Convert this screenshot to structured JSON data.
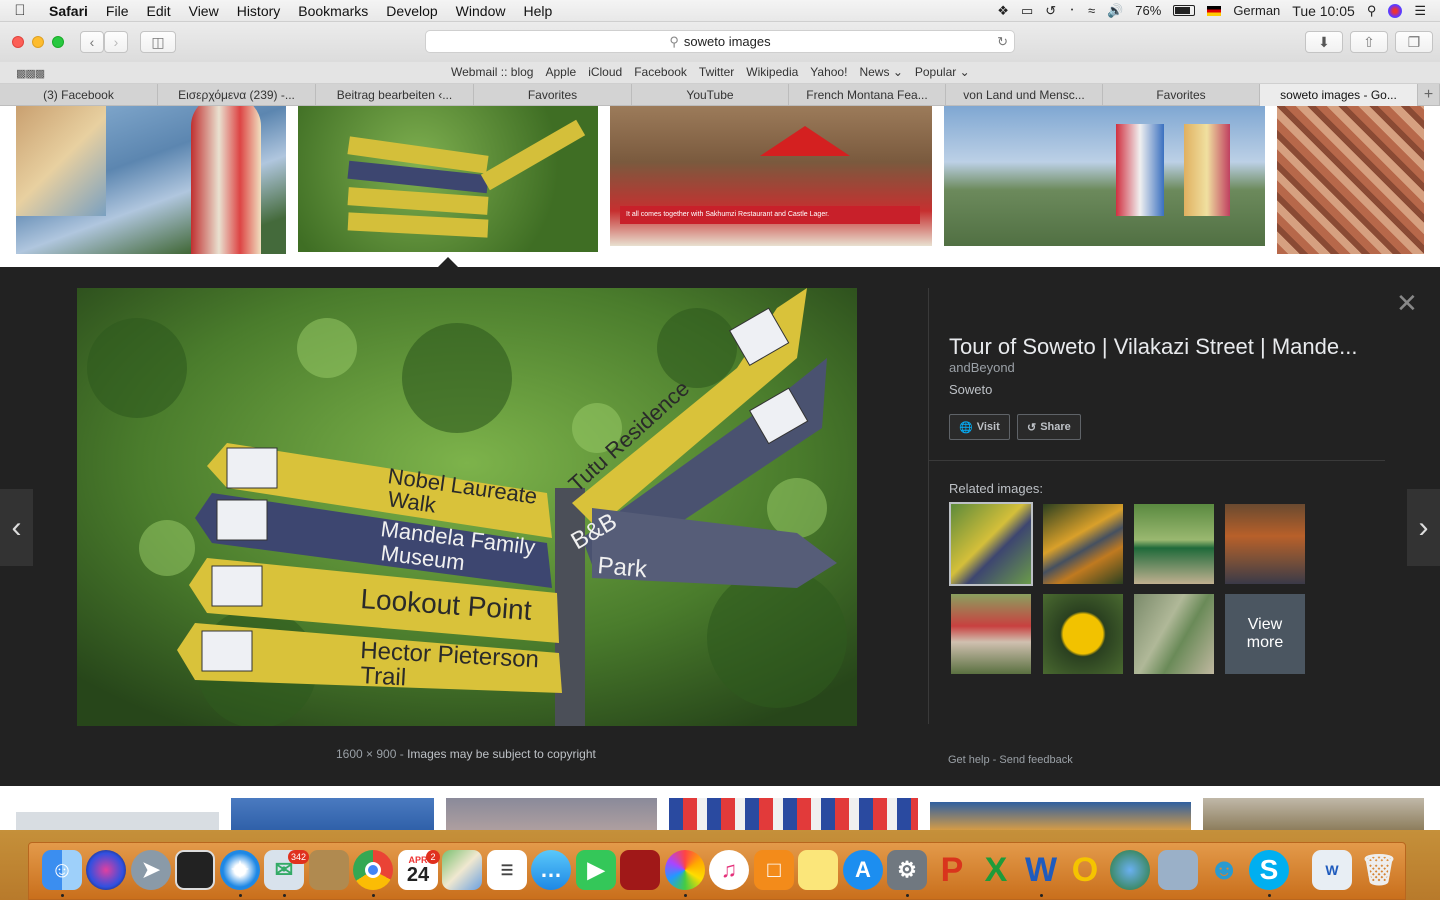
{
  "menubar": {
    "app": "Safari",
    "items": [
      "File",
      "Edit",
      "View",
      "History",
      "Bookmarks",
      "Develop",
      "Window",
      "Help"
    ],
    "battery": "76%",
    "language": "German",
    "clock": "Tue 10:05"
  },
  "toolbar": {
    "url": "soweto images"
  },
  "favorites": [
    "Webmail :: blog",
    "Apple",
    "iCloud",
    "Facebook",
    "Twitter",
    "Wikipedia",
    "Yahoo!",
    "News",
    "Popular"
  ],
  "tabs": [
    "(3) Facebook",
    "Εισερχόμενα (239) -...",
    "Beitrag bearbeiten ‹...",
    "Favorites",
    "YouTube",
    "French Montana Fea...",
    "von Land und Mensc...",
    "Favorites",
    "soweto images - Go..."
  ],
  "preview": {
    "title": "Tour of Soweto | Vilakazi Street | Mande...",
    "source": "andBeyond",
    "description": "Soweto",
    "visit_label": "Visit",
    "share_label": "Share",
    "dimensions": "1600 × 900",
    "separator": "-",
    "copyright": "Images may be subject to copyright",
    "related_label": "Related images:",
    "view_more_1": "View",
    "view_more_2": "more",
    "get_help": "Get help",
    "send_feedback": "Send feedback"
  },
  "signs": {
    "sign1a": "Nobel Laureate",
    "sign1b": "Walk",
    "sign2a": "Mandela Family",
    "sign2b": "Museum",
    "sign3": "Lookout Point",
    "sign4a": "Hector Pieterson",
    "sign4b": "Trail",
    "sign5": "Tutu Residence",
    "sign6a": "B&B",
    "sign6b": "Park"
  },
  "thumb_caption": "It all comes together with Sakhumzi Restaurant and Castle Lager.",
  "dock_badges": {
    "mail": "342",
    "calendar": "2",
    "calendar_month": "APR",
    "calendar_day": "24"
  },
  "colors": {
    "panel": "#222222",
    "accent_sign": "#d9c23a"
  }
}
